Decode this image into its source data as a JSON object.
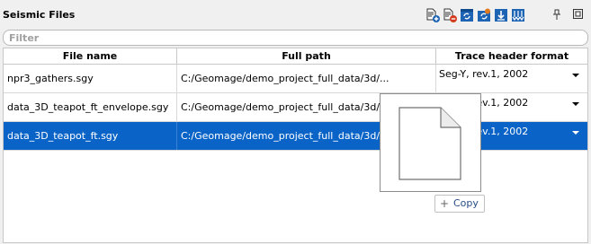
{
  "panel": {
    "title": "Seismic Files",
    "filter_placeholder": "Filter"
  },
  "toolbar": {
    "icons": [
      "add-file-icon",
      "remove-file-icon",
      "refresh-icon",
      "reload-icon",
      "download-icon",
      "import-traces-icon"
    ],
    "pin_icon": "pin-icon",
    "float_icon": "float-window-icon"
  },
  "table": {
    "columns": [
      "File name",
      "Full path",
      "Trace header format"
    ],
    "rows": [
      {
        "name": "npr3_gathers.sgy",
        "path": "C:/Geomage/demo_project_full_data/3d/...",
        "format": "Seg-Y, rev.1, 2002",
        "selected": false
      },
      {
        "name": "data_3D_teapot_ft_envelope.sgy",
        "path": "C:/Geomage/demo_project_full_data/3d/...",
        "format": "Seg-Y, rev.1, 2002",
        "selected": false
      },
      {
        "name": "data_3D_teapot_ft.sgy",
        "path": "C:/Geomage/demo_project_full_data/3d/...",
        "format": "Seg-Y, rev.1, 2002",
        "selected": true
      }
    ]
  },
  "drag": {
    "copy_label": "Copy",
    "copy_symbol": "+"
  },
  "colors": {
    "selection": "#0a64c8",
    "toolbar_blue": "#1e64b4"
  }
}
